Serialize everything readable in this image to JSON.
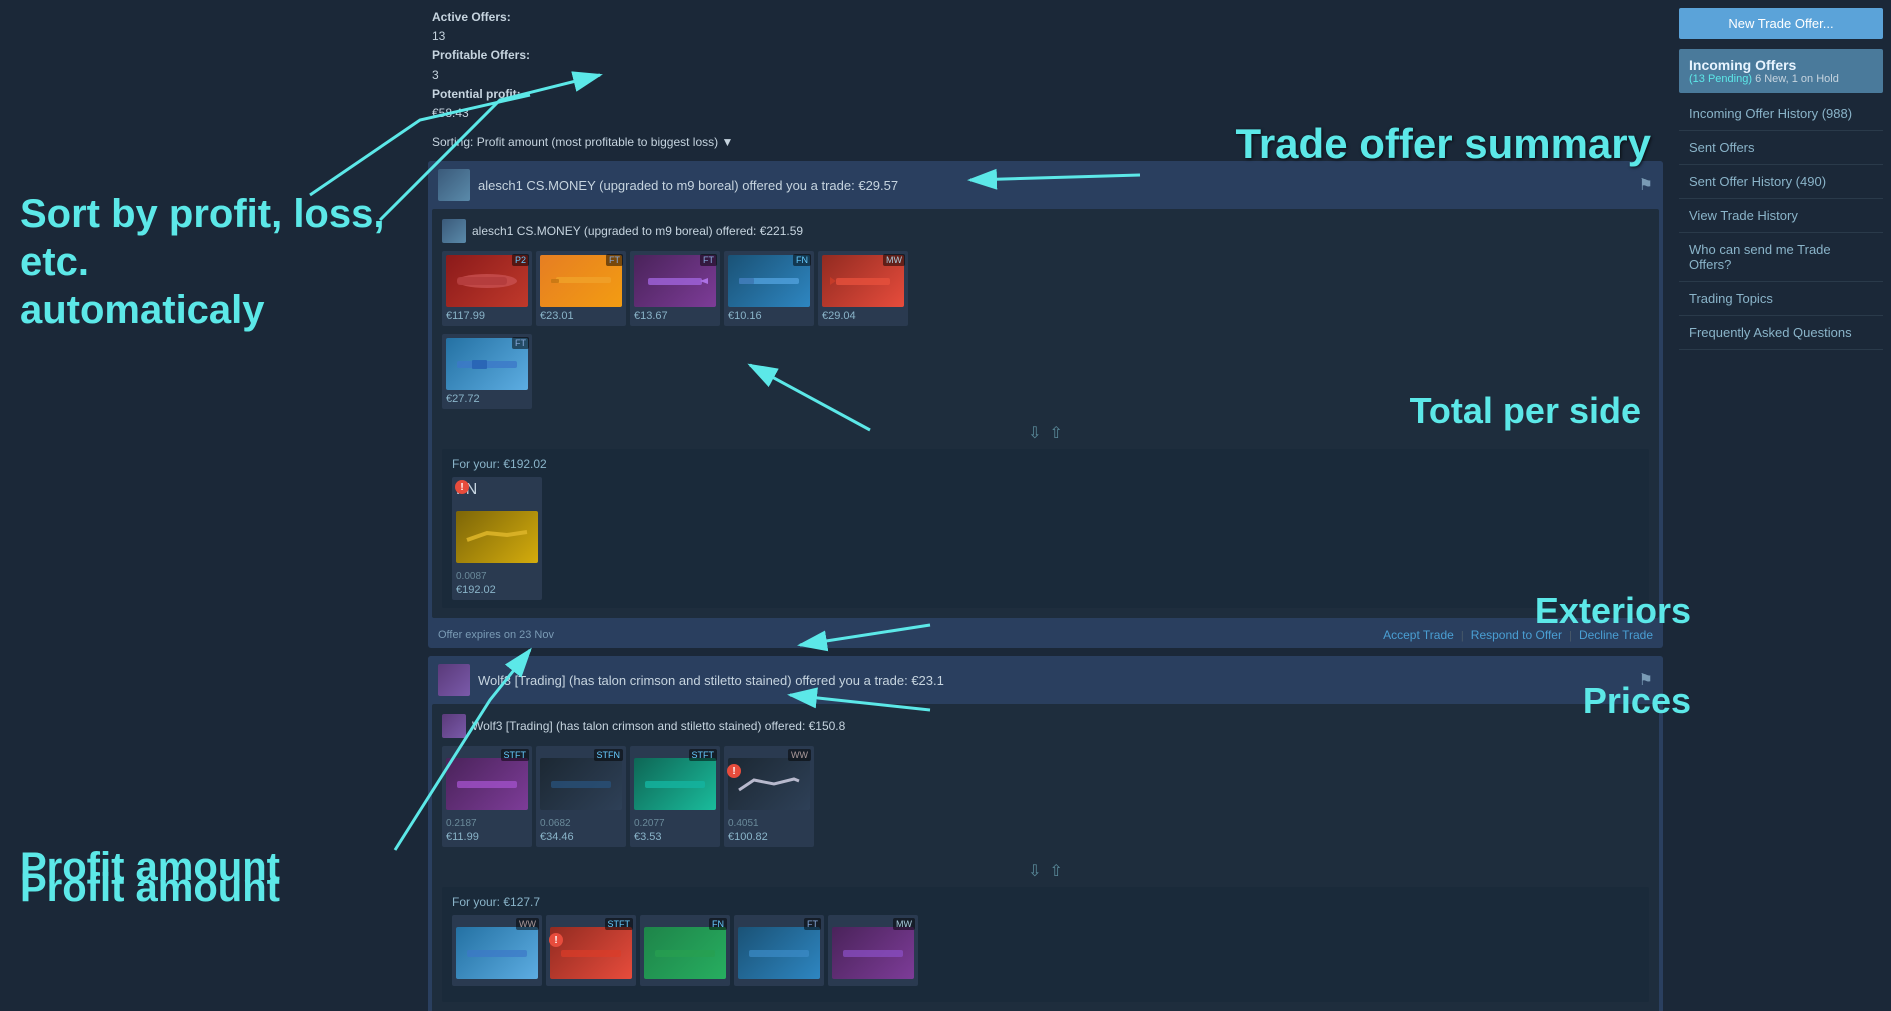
{
  "stats": {
    "active_offers_label": "Active Offers:",
    "active_offers_value": "13",
    "profitable_label": "Profitable Offers:",
    "profitable_value": "3",
    "potential_label": "Potential profit:",
    "potential_value": "€58.43"
  },
  "sorting": {
    "label": "Sorting:",
    "value": "Profit amount (most profitable to biggest loss)"
  },
  "trade1": {
    "header_text": "alesch1 CS.MONEY (upgraded to m9 boreal) offered you a trade: €29.57",
    "inner_header": "alesch1 CS.MONEY (upgraded to m9 boreal) offered: €221.59",
    "items": [
      {
        "wear": "P2",
        "price": "€117.99",
        "bg": "item-bg-p2"
      },
      {
        "wear": "FT",
        "price": "€23.01",
        "bg": "item-bg-orange"
      },
      {
        "wear": "FT",
        "price": "€13.67",
        "bg": "item-bg-purple"
      },
      {
        "wear": "FN",
        "price": "€10.16",
        "bg": "item-bg-rifle"
      },
      {
        "wear": "MW",
        "price": "€29.04",
        "bg": "item-bg-red2"
      }
    ],
    "second_row": [
      {
        "wear": "FT",
        "price": "€27.72",
        "bg": "item-bg-blue"
      }
    ],
    "your_offer_label": "For your: €192.02",
    "your_items": [
      {
        "wear": "FN",
        "price": "€192.02",
        "subprice": "0.0087",
        "bg": "item-bg-gold",
        "error": true
      }
    ],
    "footer_expires": "Offer expires on 23 Nov",
    "actions": [
      "Accept Trade",
      "Respond to Offer",
      "Decline Trade"
    ]
  },
  "trade2": {
    "header_text": "Wolf3 [Trading] (has talon crimson and stiletto stained) offered you a trade: €23.1",
    "inner_header": "Wolf3 [Trading] (has talon crimson and stiletto stained) offered: €150.8",
    "items": [
      {
        "wear": "STFT",
        "price": "€11.99",
        "subprice": "0.2187",
        "bg": "item-bg-purple"
      },
      {
        "wear": "STFN",
        "price": "€34.46",
        "subprice": "0.0682",
        "bg": "item-bg-dark"
      },
      {
        "wear": "STFT",
        "price": "€3.53",
        "subprice": "0.2077",
        "bg": "item-bg-teal"
      },
      {
        "wear": "WW",
        "price": "€100.82",
        "subprice": "0.4051",
        "bg": "item-bg-dark",
        "error": true
      }
    ],
    "your_offer_label": "For your: €127.7",
    "your_items": [
      {
        "wear": "WW",
        "bg": "item-bg-blue"
      },
      {
        "wear": "STFT",
        "bg": "item-bg-red2",
        "error": true
      },
      {
        "wear": "FN",
        "bg": "item-bg-ak"
      },
      {
        "wear": "FT",
        "bg": "item-bg-rifle"
      },
      {
        "wear": "MW",
        "bg": "item-bg-purple"
      }
    ]
  },
  "sidebar": {
    "new_trade_btn": "New Trade Offer...",
    "incoming_title": "Incoming Offers",
    "incoming_sub": "(13 Pending)",
    "incoming_new": "6 New, 1 on Hold",
    "links": [
      {
        "id": "incoming-offer-history",
        "text": "Incoming Offer History (988)"
      },
      {
        "id": "sent-offers",
        "text": "Sent Offers"
      },
      {
        "id": "sent-offer-history",
        "text": "Sent Offer History (490)"
      },
      {
        "id": "view-trade-history",
        "text": "View Trade History"
      },
      {
        "id": "who-can-send",
        "text": "Who can send me Trade Offers?"
      },
      {
        "id": "trading-topics",
        "text": "Trading Topics"
      },
      {
        "id": "faq",
        "text": "Frequently Asked Questions"
      }
    ]
  },
  "annotations": {
    "sort_label": "Sort by profit, loss, etc.\nautomaticaly",
    "total_label": "Total per side",
    "exteriors_label": "Exteriors",
    "prices_label": "Prices",
    "profit_label": "Profit amount",
    "trade_summary_label": "Trade offer summary"
  }
}
